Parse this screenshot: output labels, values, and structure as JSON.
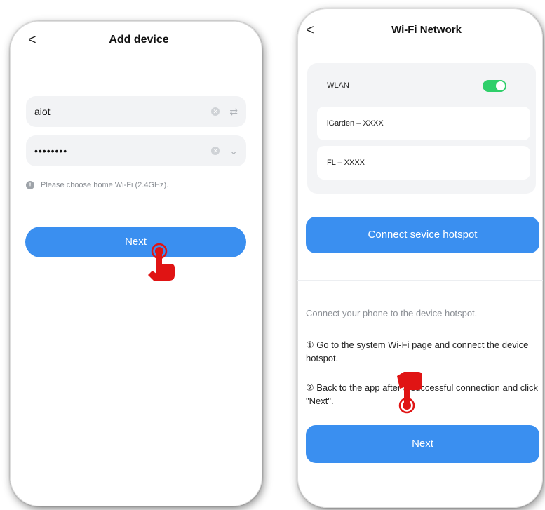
{
  "left": {
    "back": "<",
    "title": "Add device",
    "ssid_value": "aiot",
    "password_value": "••••••••",
    "hint": "Please choose home Wi-Fi (2.4GHz).",
    "next_label": "Next"
  },
  "right": {
    "back": "<",
    "title": "Wi-Fi Network",
    "wlan_label": "WLAN",
    "wlan_on": true,
    "networks": [
      "iGarden – XXXX",
      "FL – XXXX"
    ],
    "hotspot_button": "Connect sevice hotspot",
    "instruction": "Connect your phone to the device hotspot.",
    "step1": "① Go to the system Wi-Fi page and connect the device hotspot.",
    "step2": "② Back to the app after a successful connection and click \"Next\".",
    "next_label": "Next"
  },
  "colors": {
    "accent": "#3a8ff0",
    "toggle_on": "#2fcf6a",
    "pointer": "#e01414"
  },
  "icons": [
    "back-icon",
    "clear-icon",
    "swap-icon",
    "chevron-down-icon",
    "info-icon",
    "toggle",
    "hand-pointer-icon"
  ]
}
